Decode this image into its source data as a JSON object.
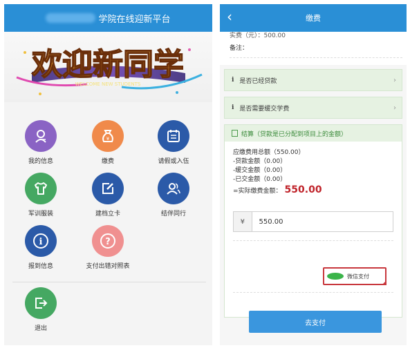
{
  "left": {
    "header_title": "学院在线迎新平台",
    "banner_main": "欢迎新同学",
    "banner_sub": "WELCOME NEW STUDENTS",
    "tiles": [
      {
        "label": "我的信息",
        "icon": "user-card-icon",
        "color": "#8a63c4"
      },
      {
        "label": "缴费",
        "icon": "money-bag-icon",
        "color": "#f08a4b"
      },
      {
        "label": "请假或入伍",
        "icon": "calendar-list-icon",
        "color": "#2b5aa8"
      },
      {
        "label": "军训服装",
        "icon": "tshirt-icon",
        "color": "#45a862"
      },
      {
        "label": "建档立卡",
        "icon": "edit-icon",
        "color": "#2b5aa8"
      },
      {
        "label": "结伴同行",
        "icon": "people-icon",
        "color": "#2b5aa8"
      },
      {
        "label": "报到信息",
        "icon": "info-icon",
        "color": "#2b5aa8"
      },
      {
        "label": "支付出错对照表",
        "icon": "question-icon",
        "color": "#f09090"
      },
      {
        "label": "退出",
        "icon": "logout-icon",
        "color": "#45a862"
      }
    ]
  },
  "right": {
    "header_title": "缴费",
    "back_icon": "back-chevron-icon",
    "cut_line": "实费（元）：500.00",
    "remark_label": "备注：",
    "loan_question": "是否已经贷款",
    "defer_question": "是否需要缓交学费",
    "settle_title": "结算（贷款是已分配到项目上的金额）",
    "settle_lines": [
      "应缴费用总额（550.00）",
      "-贷款金额（0.00）",
      "-缓交金额（0.00）",
      "-已交金额（0.00）"
    ],
    "actual_label": "=实际缴费金额：",
    "actual_amount": "550.00",
    "currency_symbol": "¥",
    "amount_value": "550.00",
    "wechat_label": "微信支付",
    "pay_button": "去支付"
  }
}
